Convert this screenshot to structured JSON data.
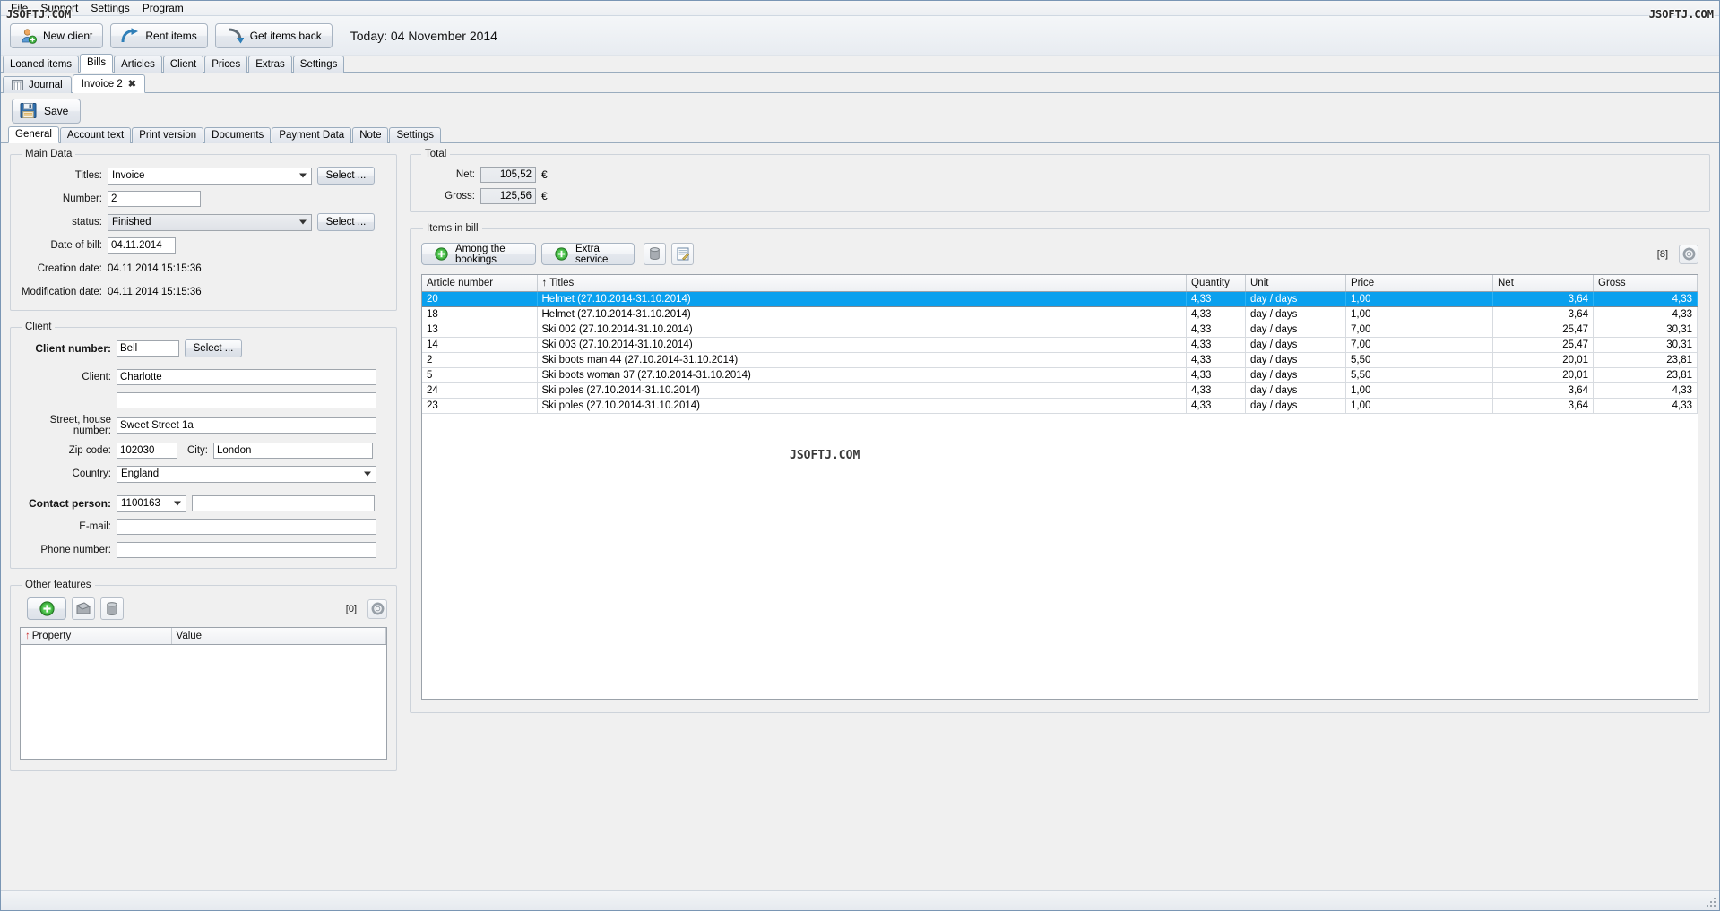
{
  "watermark": "JSOFTJ.COM",
  "menubar": {
    "items": [
      {
        "label": "File"
      },
      {
        "label": "Support"
      },
      {
        "label": "Settings"
      },
      {
        "label": "Program"
      }
    ]
  },
  "toolbar": {
    "buttons": [
      {
        "label": "New client",
        "icon": "user-add-icon"
      },
      {
        "label": "Rent items",
        "icon": "arrow-out-icon"
      },
      {
        "label": "Get items back",
        "icon": "arrow-in-icon"
      }
    ],
    "today_label": "Today: 04 November 2014"
  },
  "main_tabs": {
    "items": [
      {
        "label": "Loaned items",
        "active": false
      },
      {
        "label": "Bills",
        "active": true
      },
      {
        "label": "Articles",
        "active": false
      },
      {
        "label": "Client",
        "active": false
      },
      {
        "label": "Prices",
        "active": false
      },
      {
        "label": "Extras",
        "active": false
      },
      {
        "label": "Settings",
        "active": false
      }
    ]
  },
  "doc_tabs": {
    "items": [
      {
        "label": "Journal",
        "icon": "journal-icon",
        "active": false,
        "closable": false
      },
      {
        "label": "Invoice 2",
        "icon": "",
        "active": true,
        "closable": true
      }
    ],
    "close_glyph": "✖"
  },
  "save_bar": {
    "save_label": "Save",
    "save_icon": "floppy-disk-icon"
  },
  "inner_tabs": {
    "items": [
      {
        "label": "General",
        "active": true
      },
      {
        "label": "Account text",
        "active": false
      },
      {
        "label": "Print version",
        "active": false
      },
      {
        "label": "Documents",
        "active": false
      },
      {
        "label": "Payment Data",
        "active": false
      },
      {
        "label": "Note",
        "active": false
      },
      {
        "label": "Settings",
        "active": false
      }
    ]
  },
  "main_data": {
    "legend": "Main Data",
    "titles_label": "Titles:",
    "titles_value": "Invoice",
    "titles_select_label": "Select ...",
    "number_label": "Number:",
    "number_value": "2",
    "status_label": "status:",
    "status_value": "Finished",
    "status_select_label": "Select ...",
    "date_of_bill_label": "Date of bill:",
    "date_of_bill_value": "04.11.2014",
    "creation_date_label": "Creation date:",
    "creation_date_value": "04.11.2014  15:15:36",
    "modification_date_label": "Modification date:",
    "modification_date_value": "04.11.2014  15:15:36"
  },
  "client": {
    "legend": "Client",
    "client_number_label": "Client number:",
    "client_number_value": "Bell",
    "client_select_label": "Select ...",
    "client_label": "Client:",
    "client_value": "Charlotte",
    "client_line2_value": "",
    "street_label": "Street, house number:",
    "street_value": "Sweet Street 1a",
    "zip_label": "Zip code:",
    "zip_value": "102030",
    "city_label": "City:",
    "city_value": "London",
    "country_label": "Country:",
    "country_value": "England",
    "contact_person_label": "Contact person:",
    "contact_person_value": "1100163",
    "contact_person_name": "",
    "email_label": "E-mail:",
    "email_value": "",
    "phone_label": "Phone number:",
    "phone_value": ""
  },
  "other_features": {
    "legend": "Other features",
    "buttons": [
      {
        "icon": "add-green-icon",
        "name": "add"
      },
      {
        "icon": "edit-icon",
        "name": "edit"
      },
      {
        "icon": "delete-bin-icon",
        "name": "delete"
      }
    ],
    "count_badge": "[0]",
    "gear_icon": "gear-icon",
    "columns": [
      {
        "label": "Property",
        "sorted": true
      },
      {
        "label": "Value",
        "sorted": false
      }
    ],
    "rows": []
  },
  "total": {
    "legend": "Total",
    "net_label": "Net:",
    "net_value": "105,52",
    "gross_label": "Gross:",
    "gross_value": "125,56",
    "currency": "€"
  },
  "items_in_bill": {
    "legend": "Items in bill",
    "buttons": [
      {
        "label": "Among the bookings",
        "icon": "add-green-icon"
      },
      {
        "label": "Extra service",
        "icon": "add-green-icon"
      }
    ],
    "icon_buttons": [
      {
        "icon": "delete-bin-icon",
        "name": "delete-item"
      },
      {
        "icon": "edit-note-icon",
        "name": "edit-item"
      }
    ],
    "count_badge": "[8]",
    "gear_icon": "gear-icon",
    "columns": [
      {
        "label": "Article number",
        "sorted": false,
        "align": "left"
      },
      {
        "label": "Titles",
        "sorted": true,
        "align": "left"
      },
      {
        "label": "Quantity",
        "sorted": false,
        "align": "left"
      },
      {
        "label": "Unit",
        "sorted": false,
        "align": "left"
      },
      {
        "label": "Price",
        "sorted": false,
        "align": "left"
      },
      {
        "label": "Net",
        "sorted": false,
        "align": "right"
      },
      {
        "label": "Gross",
        "sorted": false,
        "align": "right"
      }
    ],
    "sort_glyph": "↑",
    "rows": [
      {
        "article_number": "20",
        "title": "Helmet (27.10.2014-31.10.2014)",
        "quantity": "4,33",
        "unit": "day / days",
        "price": "1,00",
        "net": "3,64",
        "gross": "4,33",
        "selected": true
      },
      {
        "article_number": "18",
        "title": "Helmet (27.10.2014-31.10.2014)",
        "quantity": "4,33",
        "unit": "day / days",
        "price": "1,00",
        "net": "3,64",
        "gross": "4,33",
        "selected": false
      },
      {
        "article_number": "13",
        "title": "Ski 002 (27.10.2014-31.10.2014)",
        "quantity": "4,33",
        "unit": "day / days",
        "price": "7,00",
        "net": "25,47",
        "gross": "30,31",
        "selected": false
      },
      {
        "article_number": "14",
        "title": "Ski 003 (27.10.2014-31.10.2014)",
        "quantity": "4,33",
        "unit": "day / days",
        "price": "7,00",
        "net": "25,47",
        "gross": "30,31",
        "selected": false
      },
      {
        "article_number": "2",
        "title": "Ski boots man 44 (27.10.2014-31.10.2014)",
        "quantity": "4,33",
        "unit": "day / days",
        "price": "5,50",
        "net": "20,01",
        "gross": "23,81",
        "selected": false
      },
      {
        "article_number": "5",
        "title": "Ski boots woman 37 (27.10.2014-31.10.2014)",
        "quantity": "4,33",
        "unit": "day / days",
        "price": "5,50",
        "net": "20,01",
        "gross": "23,81",
        "selected": false
      },
      {
        "article_number": "24",
        "title": "Ski poles (27.10.2014-31.10.2014)",
        "quantity": "4,33",
        "unit": "day / days",
        "price": "1,00",
        "net": "3,64",
        "gross": "4,33",
        "selected": false
      },
      {
        "article_number": "23",
        "title": "Ski poles (27.10.2014-31.10.2014)",
        "quantity": "4,33",
        "unit": "day / days",
        "price": "1,00",
        "net": "3,64",
        "gross": "4,33",
        "selected": false
      }
    ]
  },
  "colors": {
    "selection": "#0aa0ee",
    "accent_green": "#49b749",
    "window_border": "#7a96b4",
    "panel_bg": "#f0f0f0"
  }
}
